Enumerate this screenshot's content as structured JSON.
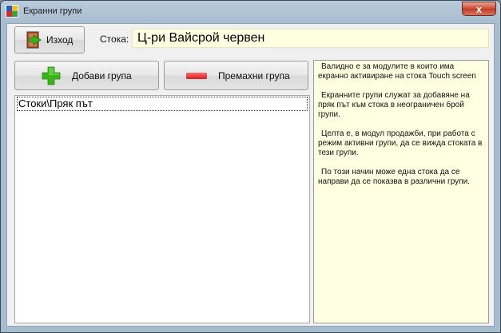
{
  "window": {
    "title": "Екранни групи",
    "close_glyph": "x"
  },
  "toolbar": {
    "exit_label": "Изход",
    "exit_icon": "exit-door-icon"
  },
  "item": {
    "label": "Стока:",
    "value": "Ц-ри Вайсрой червен"
  },
  "actions": {
    "add_label": "Добави група",
    "remove_label": "Премахни група",
    "add_icon": "plus-icon",
    "remove_icon": "minus-icon"
  },
  "groups": [
    {
      "label": "Стоки\\Пряк път"
    }
  ],
  "info": {
    "paragraphs": [
      "Валидно е за модулите в които има екранно активиране на стока Touch screen",
      "Екранните групи служат за добавяне на пряк път към стока в неограничен брой групи.",
      "Целта е, в модул продажби, при работа с режим активни групи, да се вижда стоката в тези групи.",
      "По този начин може една стока да се направи да се показва в различни групи."
    ]
  },
  "colors": {
    "note_bg": "#ffffe1",
    "close_red": "#c03a23",
    "plus_green": "#3cb31b",
    "minus_red": "#d61f1f"
  }
}
